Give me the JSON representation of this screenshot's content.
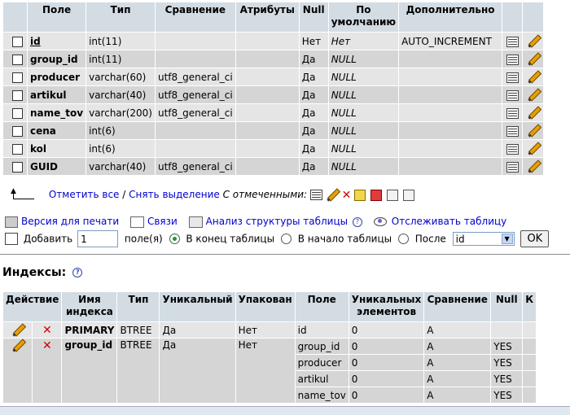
{
  "structure": {
    "headers": [
      "",
      "Поле",
      "Тип",
      "Сравнение",
      "Атрибуты",
      "Null",
      "По умолчанию",
      "Дополнительно",
      "",
      ""
    ],
    "rows": [
      {
        "field": "id",
        "type": "int(11)",
        "collation": "",
        "attributes": "",
        "null": "Нет",
        "default": "Нет",
        "extra": "AUTO_INCREMENT"
      },
      {
        "field": "group_id",
        "type": "int(11)",
        "collation": "",
        "attributes": "",
        "null": "Да",
        "default": "NULL",
        "extra": ""
      },
      {
        "field": "producer",
        "type": "varchar(60)",
        "collation": "utf8_general_ci",
        "attributes": "",
        "null": "Да",
        "default": "NULL",
        "extra": ""
      },
      {
        "field": "artikul",
        "type": "varchar(40)",
        "collation": "utf8_general_ci",
        "attributes": "",
        "null": "Да",
        "default": "NULL",
        "extra": ""
      },
      {
        "field": "name_tov",
        "type": "varchar(200)",
        "collation": "utf8_general_ci",
        "attributes": "",
        "null": "Да",
        "default": "NULL",
        "extra": ""
      },
      {
        "field": "cena",
        "type": "int(6)",
        "collation": "",
        "attributes": "",
        "null": "Да",
        "default": "NULL",
        "extra": ""
      },
      {
        "field": "kol",
        "type": "int(6)",
        "collation": "",
        "attributes": "",
        "null": "Да",
        "default": "NULL",
        "extra": ""
      },
      {
        "field": "GUID",
        "type": "varchar(40)",
        "collation": "utf8_general_ci",
        "attributes": "",
        "null": "Да",
        "default": "NULL",
        "extra": ""
      }
    ]
  },
  "check_row": {
    "check_all": "Отметить все",
    "separator": "/",
    "uncheck_all": "Снять выделение",
    "with_selected": "С отмеченными:"
  },
  "links": {
    "print": "Версия для печати",
    "relations": "Связи",
    "analyze": "Анализ структуры таблицы",
    "track": "Отслеживать таблицу"
  },
  "add_row": {
    "add_label": "Добавить",
    "count_value": "1",
    "fields_label": "поле(я)",
    "end_label": "В конец таблицы",
    "begin_label": "В начало таблицы",
    "after_label": "После",
    "after_value": "id",
    "ok_label": "OK"
  },
  "indexes": {
    "title": "Индексы:",
    "headers": [
      "Действие",
      "Имя индекса",
      "Тип",
      "Уникальный",
      "Упакован",
      "Поле",
      "Уникальных элементов",
      "Сравнение",
      "Null",
      "К"
    ],
    "primary": {
      "name": "PRIMARY",
      "type": "BTREE",
      "unique": "Да",
      "packed": "Нет",
      "columns": [
        {
          "field": "id",
          "cardinality": "0",
          "collation": "A",
          "null": ""
        }
      ]
    },
    "group": {
      "name": "group_id",
      "type": "BTREE",
      "unique": "Да",
      "packed": "Нет",
      "columns": [
        {
          "field": "group_id",
          "cardinality": "0",
          "collation": "A",
          "null": "YES"
        },
        {
          "field": "producer",
          "cardinality": "0",
          "collation": "A",
          "null": "YES"
        },
        {
          "field": "artikul",
          "cardinality": "0",
          "collation": "A",
          "null": "YES"
        },
        {
          "field": "name_tov",
          "cardinality": "0",
          "collation": "A",
          "null": "YES"
        }
      ]
    }
  }
}
